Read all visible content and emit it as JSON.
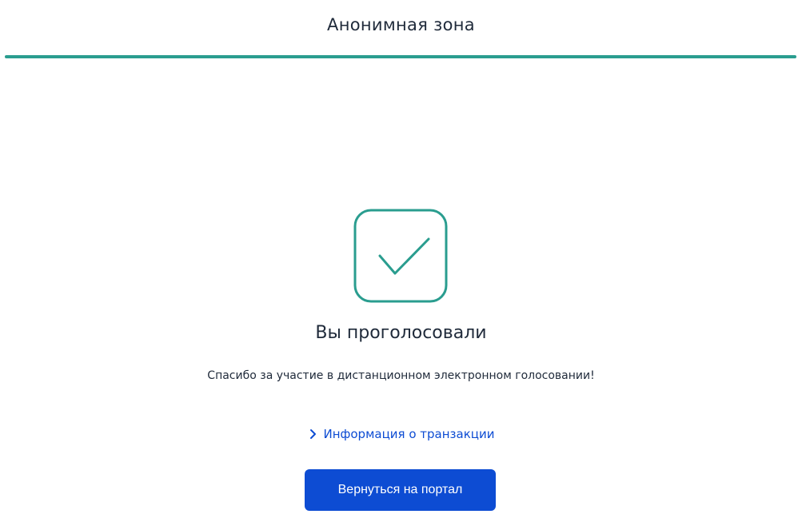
{
  "header": {
    "title": "Анонимная зона"
  },
  "result": {
    "title": "Вы проголосовали",
    "message": "Спасибо за участие в дистанционном электронном голосовании!"
  },
  "links": {
    "transaction_info": "Информация о транзакции"
  },
  "actions": {
    "return_label": "Вернуться на портал"
  },
  "icons": {
    "success": "checkmark-square-icon",
    "link_chevron": "chevron-right-icon"
  },
  "colors": {
    "accent": "#2a9d8f",
    "primary": "#0d4cd3",
    "text": "#1f2a3a"
  }
}
